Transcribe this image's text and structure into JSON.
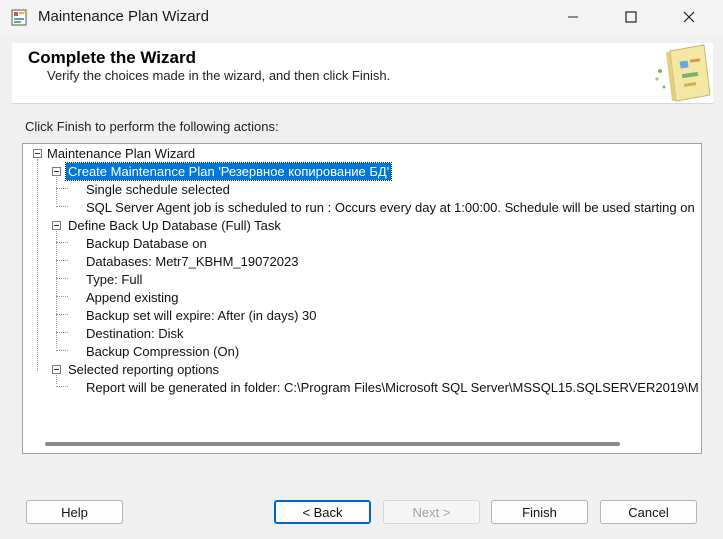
{
  "window": {
    "title": "Maintenance Plan Wizard",
    "controls": [
      "minimize",
      "maximize",
      "close"
    ]
  },
  "header": {
    "title": "Complete the Wizard",
    "subtitle": "Verify the choices made in the wizard, and then click Finish."
  },
  "instruction": "Click Finish to perform the following actions:",
  "tree": {
    "root": "Maintenance Plan Wizard",
    "group1": {
      "label": "Create Maintenance Plan 'Резервное копирование БД'",
      "items": [
        "Single schedule selected",
        "SQL Server Agent job is scheduled to run : Occurs every day at 1:00:00. Schedule will be used starting on"
      ]
    },
    "group2": {
      "label": "Define Back Up Database (Full) Task",
      "items": [
        "Backup Database on",
        "Databases: Metr7_KBHM_19072023",
        "Type: Full",
        "Append existing",
        "Backup set will expire: After (in days) 30",
        "Destination: Disk",
        "Backup Compression (On)"
      ]
    },
    "group3": {
      "label": "Selected reporting options",
      "items": [
        "Report will be generated in folder: C:\\Program Files\\Microsoft SQL Server\\MSSQL15.SQLSERVER2019\\M"
      ]
    }
  },
  "buttons": {
    "help": "Help",
    "back": "< Back",
    "next": "Next >",
    "finish": "Finish",
    "cancel": "Cancel"
  },
  "colors": {
    "selection": "#0078d7",
    "accent_border": "#0067c0"
  }
}
